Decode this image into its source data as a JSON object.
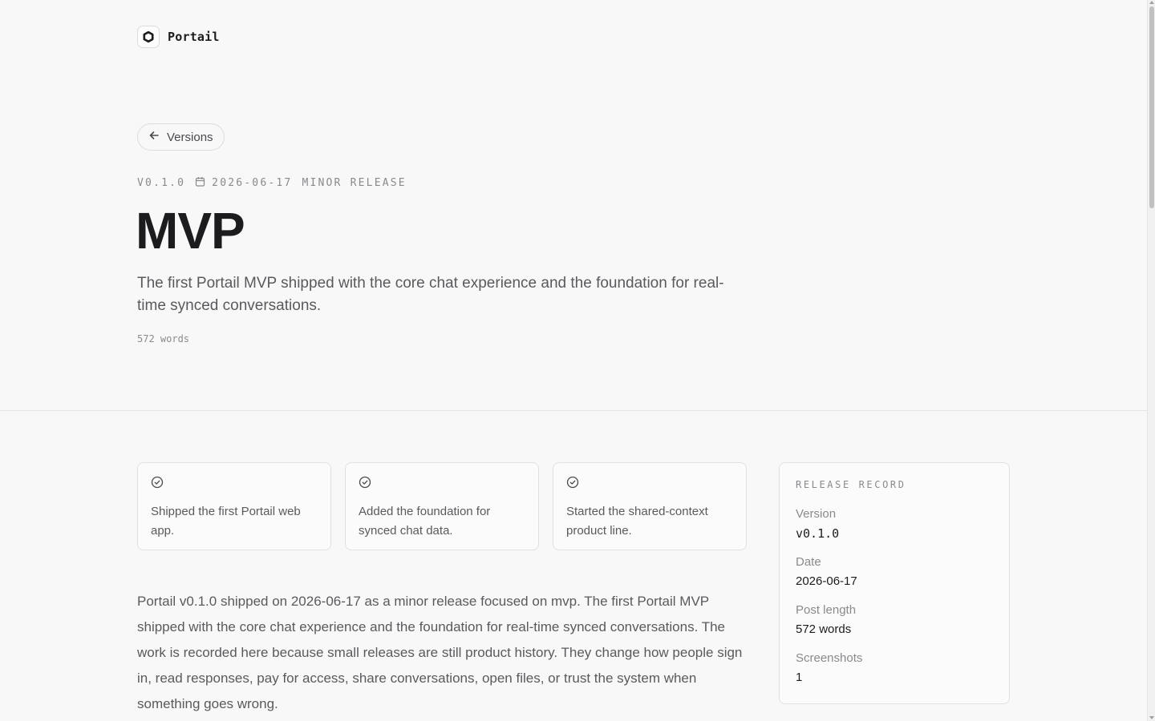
{
  "header": {
    "brand_name": "Portail",
    "logo_icon": "portail-logo-icon"
  },
  "nav": {
    "back_label": "Versions",
    "back_icon": "arrow-left-icon"
  },
  "release": {
    "version": "V0.1.0",
    "date": "2026-06-17",
    "type": "MINOR RELEASE",
    "title": "MVP",
    "lede": "The first Portail MVP shipped with the core chat experience and the foundation for real-time synced conversations.",
    "word_count": "572 words"
  },
  "highlights": [
    {
      "icon": "check-circle-icon",
      "text": "Shipped the first Portail web app."
    },
    {
      "icon": "check-circle-icon",
      "text": "Added the foundation for synced chat data."
    },
    {
      "icon": "check-circle-icon",
      "text": "Started the shared-context product line."
    }
  ],
  "body": {
    "paragraph": "Portail v0.1.0 shipped on 2026-06-17 as a minor release focused on mvp. The first Portail MVP shipped with the core chat experience and the foundation for real-time synced conversations. The work is recorded here because small releases are still product history. They change how people sign in, read responses, pay for access, share conversations, open files, or trust the system when something goes wrong."
  },
  "record": {
    "heading": "RELEASE RECORD",
    "items": [
      {
        "label": "Version",
        "value": "v0.1.0"
      },
      {
        "label": "Date",
        "value": "2026-06-17"
      },
      {
        "label": "Post length",
        "value": "572 words"
      },
      {
        "label": "Screenshots",
        "value": "1"
      }
    ]
  },
  "colors": {
    "background": "#f8f8f8",
    "text": "#1c1c1e",
    "muted": "#8a8a8e",
    "border": "#e0e0e0"
  }
}
